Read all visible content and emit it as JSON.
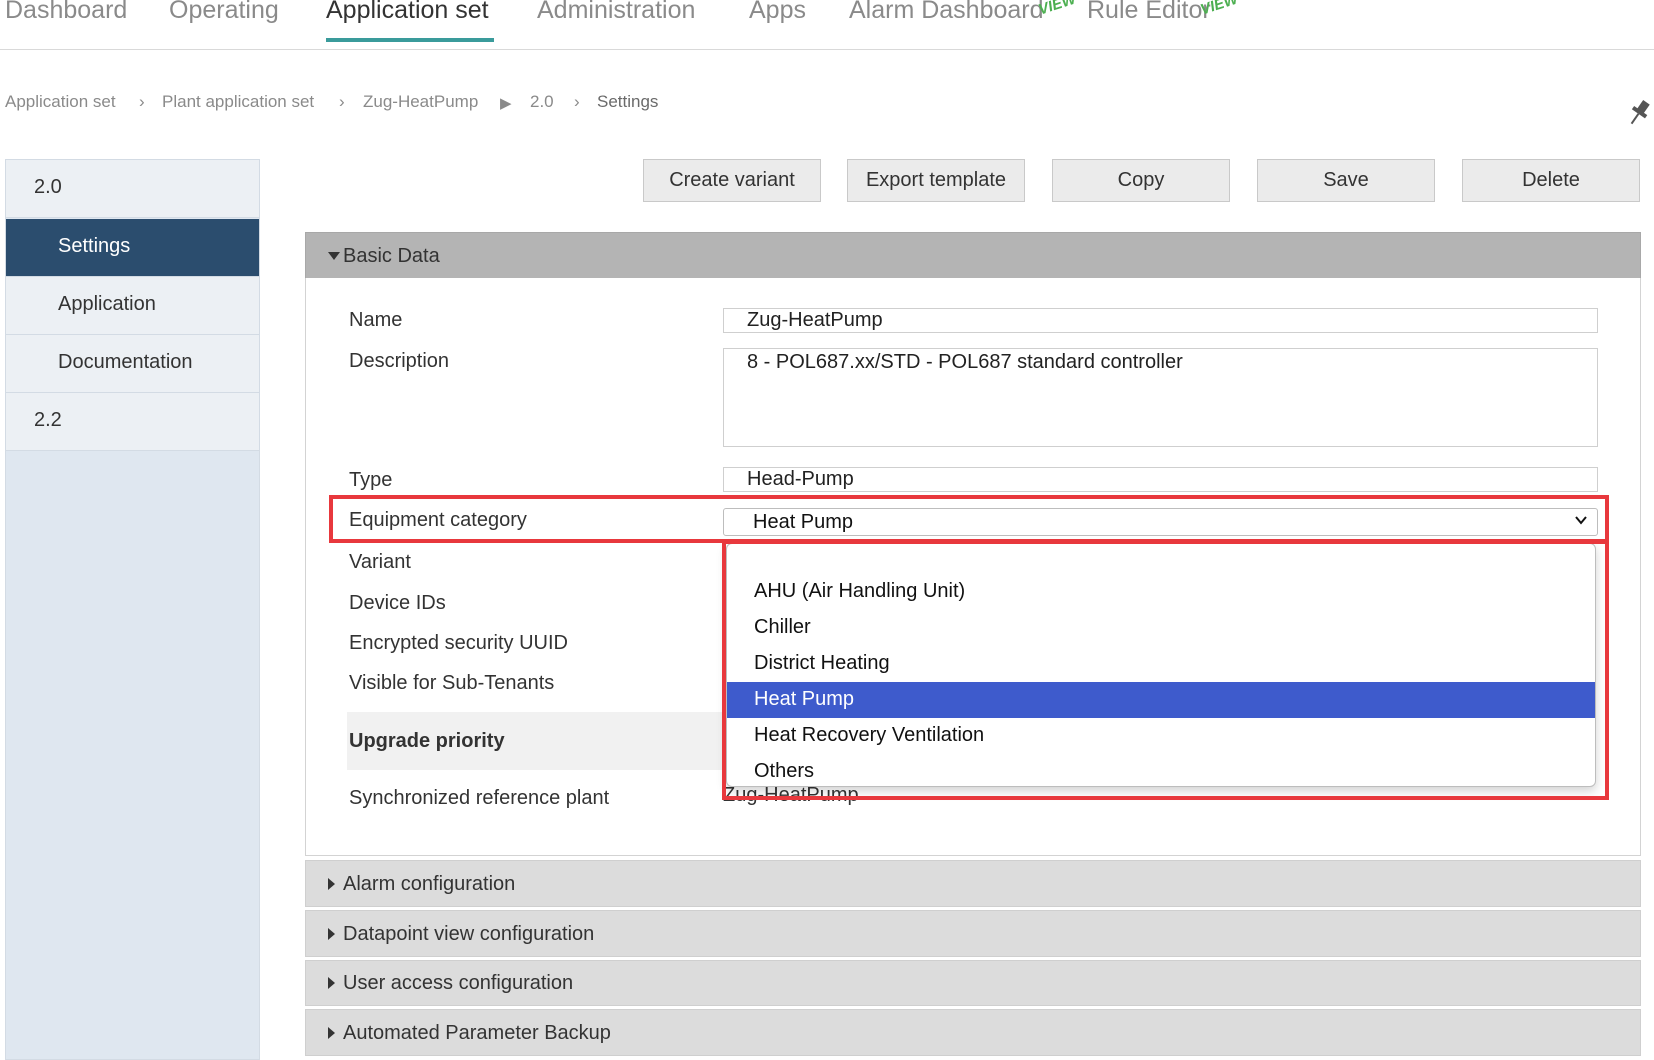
{
  "topnav": {
    "tabs": [
      {
        "label": "Dashboard"
      },
      {
        "label": "Operating"
      },
      {
        "label": "Application set"
      },
      {
        "label": "Administration"
      },
      {
        "label": "Apps"
      },
      {
        "label": "Alarm Dashboard"
      },
      {
        "label": "Rule Editor"
      }
    ],
    "active_tab": "Application set",
    "preview_badge": "VIEW"
  },
  "breadcrumb": {
    "items": [
      "Application set",
      "Plant application set",
      "Zug-HeatPump",
      "2.0",
      "Settings"
    ],
    "separators": [
      "›",
      "›",
      "▶",
      "›"
    ]
  },
  "sidebar": {
    "items": [
      {
        "label": "2.0"
      },
      {
        "label": "Settings"
      },
      {
        "label": "Application"
      },
      {
        "label": "Documentation"
      },
      {
        "label": "2.2"
      }
    ],
    "active": "Settings"
  },
  "actions": {
    "create_variant": "Create variant",
    "export_template": "Export template",
    "copy": "Copy",
    "save": "Save",
    "delete": "Delete"
  },
  "basic_data": {
    "title": "Basic Data",
    "labels": {
      "name": "Name",
      "description": "Description",
      "type": "Type",
      "equipment_category": "Equipment category",
      "variant": "Variant",
      "device_ids": "Device IDs",
      "encrypted_uuid": "Encrypted security UUID",
      "visible_sub_tenants": "Visible for Sub-Tenants",
      "upgrade_priority": "Upgrade priority",
      "sync_reference_plant": "Synchronized reference plant"
    },
    "values": {
      "name": "Zug-HeatPump",
      "description": "8 - POL687.xx/STD - POL687 standard controller",
      "type": "Head-Pump",
      "equipment_category": "Heat Pump",
      "sync_reference_plant": "Zug-HeatPump"
    },
    "equipment_options": [
      "AHU (Air Handling Unit)",
      "Chiller",
      "District Heating",
      "Heat Pump",
      "Heat Recovery Ventilation",
      "Others"
    ],
    "equipment_selected": "Heat Pump"
  },
  "sections": {
    "alarm": "Alarm configuration",
    "datapoint": "Datapoint view configuration",
    "user_access": "User access configuration",
    "backup": "Automated Parameter Backup"
  },
  "colors": {
    "accent_tab": "#3a9b9b",
    "sidebar_active": "#2b4d6e",
    "dropdown_selected": "#3e5bcc",
    "highlight": "#e8383d",
    "preview": "#4caf50"
  }
}
